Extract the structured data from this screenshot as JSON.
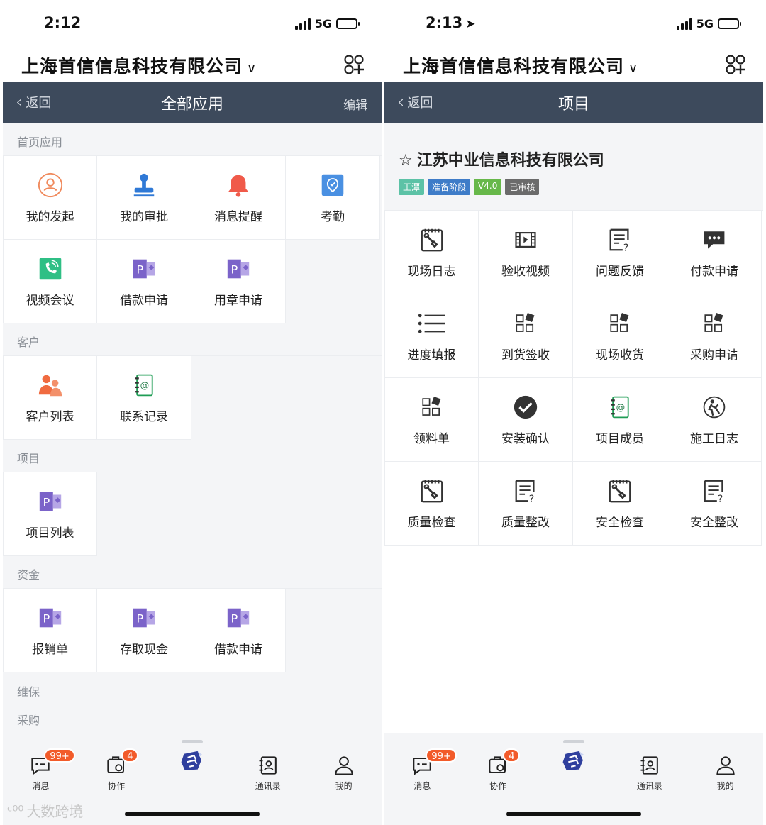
{
  "left": {
    "status": {
      "time": "2:12",
      "network": "5G"
    },
    "company": "上海首信信息科技有限公司",
    "nav": {
      "back": "返回",
      "title": "全部应用",
      "edit": "编辑"
    },
    "sections": [
      {
        "title": "首页应用",
        "items": [
          {
            "label": "我的发起",
            "icon": "user-circle-icon"
          },
          {
            "label": "我的审批",
            "icon": "stamp-icon"
          },
          {
            "label": "消息提醒",
            "icon": "bell-icon"
          },
          {
            "label": "考勤",
            "icon": "location-pin-icon"
          },
          {
            "label": "视频会议",
            "icon": "video-call-icon"
          },
          {
            "label": "借款申请",
            "icon": "p-form-icon"
          },
          {
            "label": "用章申请",
            "icon": "p-form-icon"
          }
        ]
      },
      {
        "title": "客户",
        "items": [
          {
            "label": "客户列表",
            "icon": "people-icon"
          },
          {
            "label": "联系记录",
            "icon": "address-book-icon"
          }
        ]
      },
      {
        "title": "项目",
        "items": [
          {
            "label": "项目列表",
            "icon": "p-form-icon"
          }
        ]
      },
      {
        "title": "资金",
        "items": [
          {
            "label": "报销单",
            "icon": "p-form-icon"
          },
          {
            "label": "存取现金",
            "icon": "p-form-icon"
          },
          {
            "label": "借款申请",
            "icon": "p-form-icon"
          }
        ]
      }
    ],
    "extra_titles": [
      "维保",
      "采购"
    ]
  },
  "right": {
    "status": {
      "time": "2:13",
      "network": "5G"
    },
    "company": "上海首信信息科技有限公司",
    "nav": {
      "back": "返回",
      "title": "项目"
    },
    "project": {
      "name": "江苏中业信息科技有限公司",
      "tags": [
        {
          "text": "王潭",
          "color": "#5cc2a6"
        },
        {
          "text": "准备阶段",
          "color": "#3e7cc8"
        },
        {
          "text": "V4.0",
          "color": "#67b84a"
        },
        {
          "text": "已审核",
          "color": "#6b6b6b"
        }
      ]
    },
    "items": [
      {
        "label": "现场日志",
        "icon": "clipboard-tool-icon"
      },
      {
        "label": "验收视频",
        "icon": "film-icon"
      },
      {
        "label": "问题反馈",
        "icon": "question-doc-icon"
      },
      {
        "label": "付款申请",
        "icon": "chat-bubble-icon"
      },
      {
        "label": "进度填报",
        "icon": "list-icon"
      },
      {
        "label": "到货签收",
        "icon": "blocks-icon"
      },
      {
        "label": "现场收货",
        "icon": "blocks-icon"
      },
      {
        "label": "采购申请",
        "icon": "blocks-icon"
      },
      {
        "label": "领料单",
        "icon": "blocks-icon"
      },
      {
        "label": "安装确认",
        "icon": "check-circle-icon"
      },
      {
        "label": "项目成员",
        "icon": "address-book-icon"
      },
      {
        "label": "施工日志",
        "icon": "worker-icon"
      },
      {
        "label": "质量检查",
        "icon": "clipboard-tool-icon"
      },
      {
        "label": "质量整改",
        "icon": "question-doc-icon"
      },
      {
        "label": "安全检查",
        "icon": "clipboard-tool-icon"
      },
      {
        "label": "安全整改",
        "icon": "question-doc-icon"
      }
    ]
  },
  "tabbar": {
    "items": [
      {
        "label": "消息",
        "badge": "99+"
      },
      {
        "label": "协作",
        "badge": "4"
      },
      {
        "label": "",
        "badge": ""
      },
      {
        "label": "通讯录",
        "badge": ""
      },
      {
        "label": "我的",
        "badge": ""
      }
    ]
  },
  "watermark": "大数跨境"
}
